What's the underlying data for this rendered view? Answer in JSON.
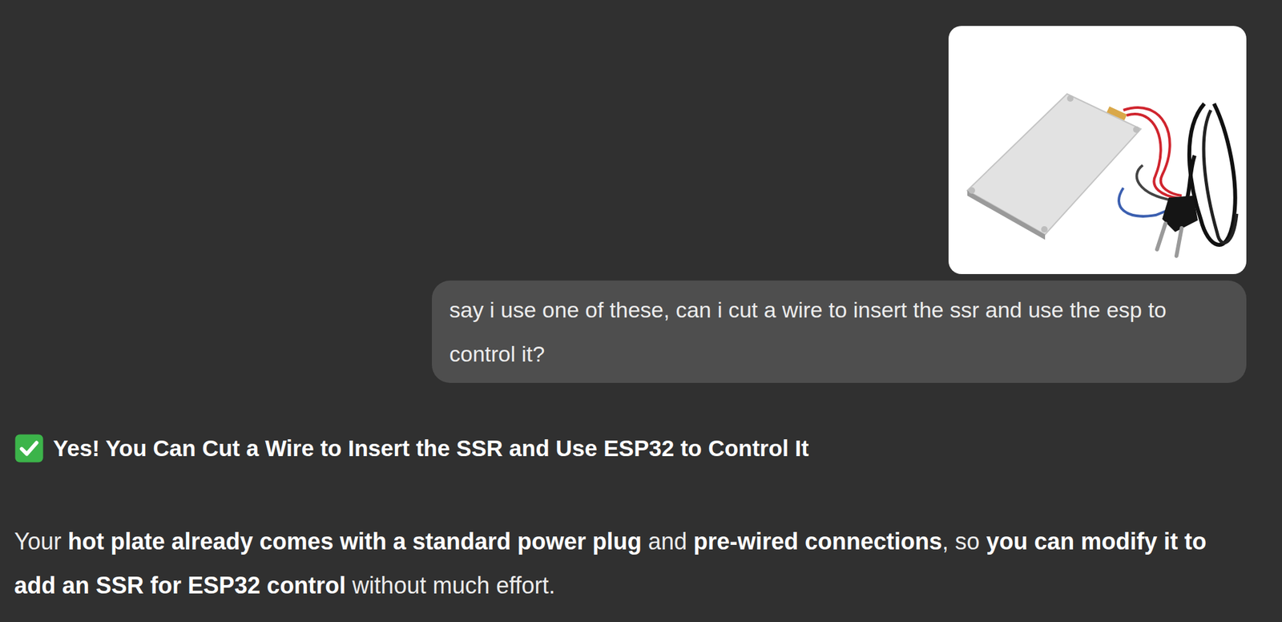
{
  "user_message": {
    "text": "say i use one of these, can i cut a wire to insert the ssr and use the esp to control it?"
  },
  "assistant_message": {
    "heading": "Yes! You Can Cut a Wire to Insert the SSR and Use ESP32 to Control It",
    "paragraph": [
      {
        "text": "Your ",
        "bold": false
      },
      {
        "text": "hot plate already comes with a standard power plug",
        "bold": true
      },
      {
        "text": " and ",
        "bold": false
      },
      {
        "text": "pre-wired connections",
        "bold": true
      },
      {
        "text": ", so ",
        "bold": false
      },
      {
        "text": "you can modify it to add an SSR for ESP32 control",
        "bold": true
      },
      {
        "text": " without much effort.",
        "bold": false
      }
    ]
  }
}
